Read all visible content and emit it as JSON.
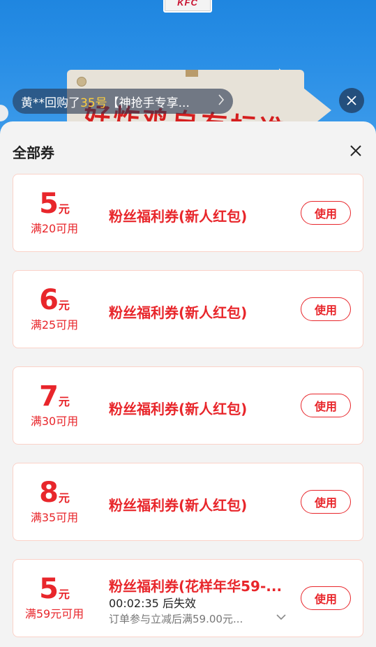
{
  "banner": {
    "logo_text": "KFC",
    "slogan": "好炸鸡自有标准"
  },
  "ticker": {
    "prefix": "黄**回购了",
    "highlight": "35号",
    "suffix": "【神抢手专享...",
    "highlight_color": "#ffcf3d"
  },
  "sheet": {
    "title": "全部券"
  },
  "colors": {
    "accent_red": "#e8262b",
    "card_border": "#fbd2c8",
    "banner_blue": "#2a8fe6"
  },
  "coupons": [
    {
      "amount": "5",
      "unit": "元",
      "condition": "满20可用",
      "title": "粉丝福利券(新人红包)",
      "button": "使用"
    },
    {
      "amount": "6",
      "unit": "元",
      "condition": "满25可用",
      "title": "粉丝福利券(新人红包)",
      "button": "使用"
    },
    {
      "amount": "7",
      "unit": "元",
      "condition": "满30可用",
      "title": "粉丝福利券(新人红包)",
      "button": "使用"
    },
    {
      "amount": "8",
      "unit": "元",
      "condition": "满35可用",
      "title": "粉丝福利券(新人红包)",
      "button": "使用"
    },
    {
      "amount": "5",
      "unit": "元",
      "condition": "满59元可用",
      "title": "粉丝福利券(花样年华59-...",
      "button": "使用",
      "timer": "00:02:35 后失效",
      "description": "订单参与立减后满59.00元..."
    }
  ]
}
